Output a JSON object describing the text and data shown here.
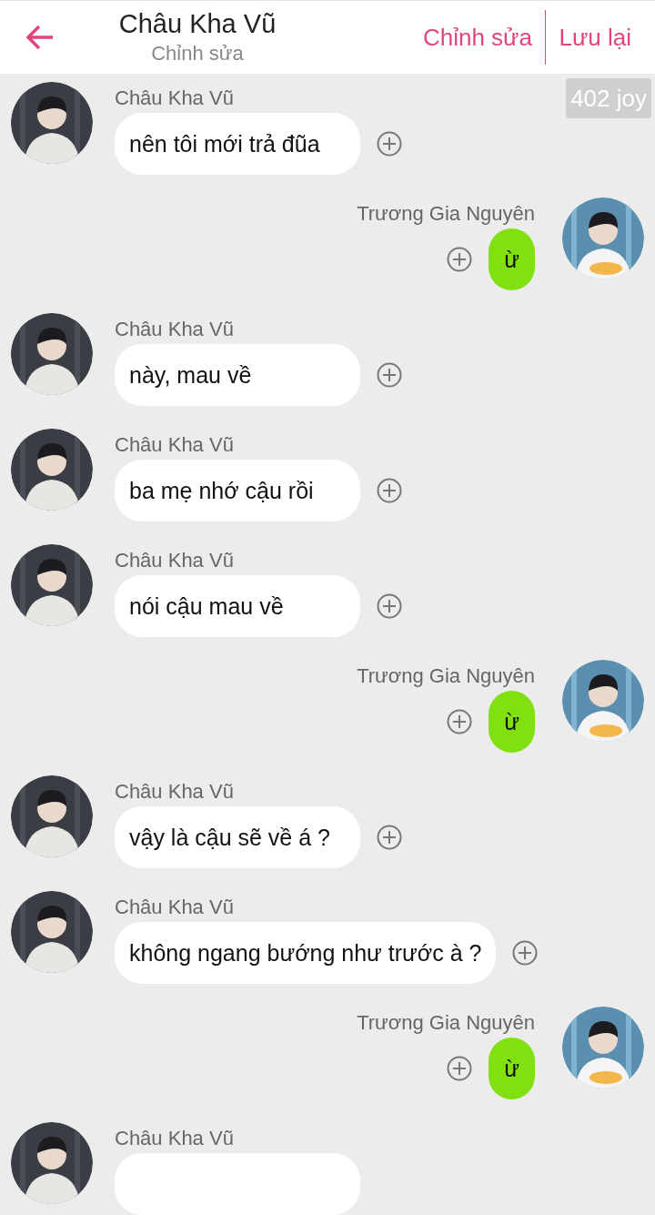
{
  "header": {
    "title": "Châu Kha Vũ",
    "subtitle": "Chỉnh sửa",
    "actions": [
      "Chỉnh sửa",
      "Lưu lại"
    ]
  },
  "badge": "402 joy",
  "messages": [
    {
      "kind": "incoming",
      "sender": "Châu Kha Vũ",
      "text": "nên tôi mới trả đũa"
    },
    {
      "kind": "outgoing",
      "sender": "Trương Gia Nguyên",
      "text": "ừ"
    },
    {
      "kind": "incoming",
      "sender": "Châu Kha Vũ",
      "text": "này, mau về"
    },
    {
      "kind": "incoming",
      "sender": "Châu Kha Vũ",
      "text": "ba mẹ nhớ cậu rồi"
    },
    {
      "kind": "incoming",
      "sender": "Châu Kha Vũ",
      "text": "nói cậu mau về"
    },
    {
      "kind": "outgoing",
      "sender": "Trương Gia Nguyên",
      "text": "ừ"
    },
    {
      "kind": "incoming",
      "sender": "Châu Kha Vũ",
      "text": "vậy là cậu sẽ về á ?"
    },
    {
      "kind": "incoming",
      "sender": "Châu Kha Vũ",
      "text": "không ngang bướng như trước à ?"
    },
    {
      "kind": "outgoing",
      "sender": "Trương Gia Nguyên",
      "text": "ừ"
    },
    {
      "kind": "incoming",
      "sender": "Châu Kha Vũ"
    }
  ]
}
